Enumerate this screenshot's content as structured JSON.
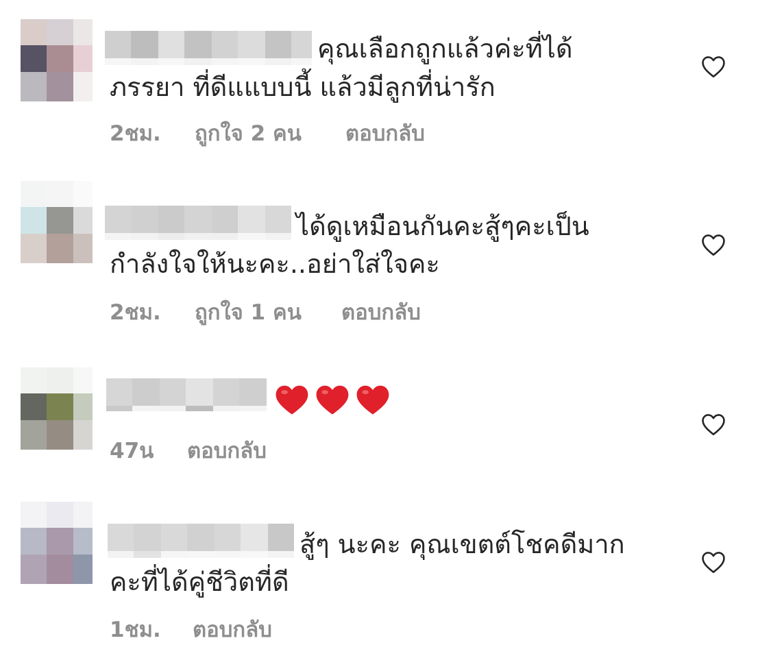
{
  "comments": [
    {
      "line1": "คุณเลือกถูกแล้วค่ะที่ได้",
      "line2": "ภรรยา ที่ดีแแบบนี้ แล้วมีลูกที่น่ารัก",
      "time": "2ชม.",
      "likes": "ถูกใจ 2 คน",
      "reply": "ตอบกลับ",
      "like_icon": "heart-outline-icon"
    },
    {
      "line1": "ได้ดูเหมือนกันคะสู้ๆคะเป็น",
      "line2": "กำลังใจให้นะคะ..อย่าใส่ใจคะ",
      "time": "2ชม.",
      "likes": "ถูกใจ 1 คน",
      "reply": "ตอบกลับ",
      "like_icon": "heart-outline-icon"
    },
    {
      "line1": "❤️❤️❤️",
      "time": "47น",
      "reply": "ตอบกลับ",
      "like_icon": "heart-outline-icon"
    },
    {
      "line1": "สู้ๆ นะคะ คุณเขตต์โชคดีมาก",
      "line2": "คะที่ได้คู่ชีวิตที่ดี",
      "time": "1ชม.",
      "reply": "ตอบกลับ",
      "like_icon": "heart-outline-icon"
    }
  ],
  "colors": {
    "text": "#262626",
    "meta": "#8e8e8e",
    "emoji_heart": "#e0202a"
  }
}
